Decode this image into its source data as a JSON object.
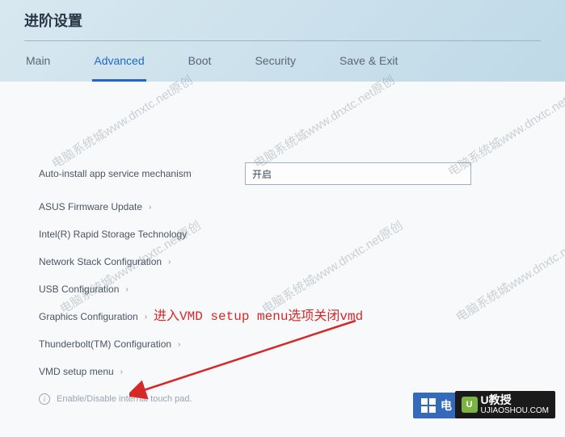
{
  "header": {
    "title": "进阶设置"
  },
  "tabs": [
    {
      "label": "Main",
      "active": false
    },
    {
      "label": "Advanced",
      "active": true
    },
    {
      "label": "Boot",
      "active": false
    },
    {
      "label": "Security",
      "active": false
    },
    {
      "label": "Save & Exit",
      "active": false
    }
  ],
  "settings": {
    "auto_service": {
      "label": "Auto-install app service mechanism",
      "value": "开启"
    }
  },
  "menu_items": [
    {
      "label": "ASUS Firmware Update"
    },
    {
      "label": "Intel(R) Rapid Storage Technology"
    },
    {
      "label": "Network Stack Configuration"
    },
    {
      "label": "USB Configuration"
    },
    {
      "label": "Graphics Configuration"
    },
    {
      "label": "Thunderbolt(TM) Configuration"
    },
    {
      "label": "VMD setup menu"
    }
  ],
  "footer": {
    "hint": "Enable/Disable internal touch pad."
  },
  "annotation": {
    "text": "进入VMD setup menu选项关闭vmd"
  },
  "watermark": "电脑系统城www.dnxtc.net原创",
  "branding": {
    "blue_text": "电",
    "logo_main": "U教授",
    "logo_sub": "UJIAOSHOU.COM"
  }
}
